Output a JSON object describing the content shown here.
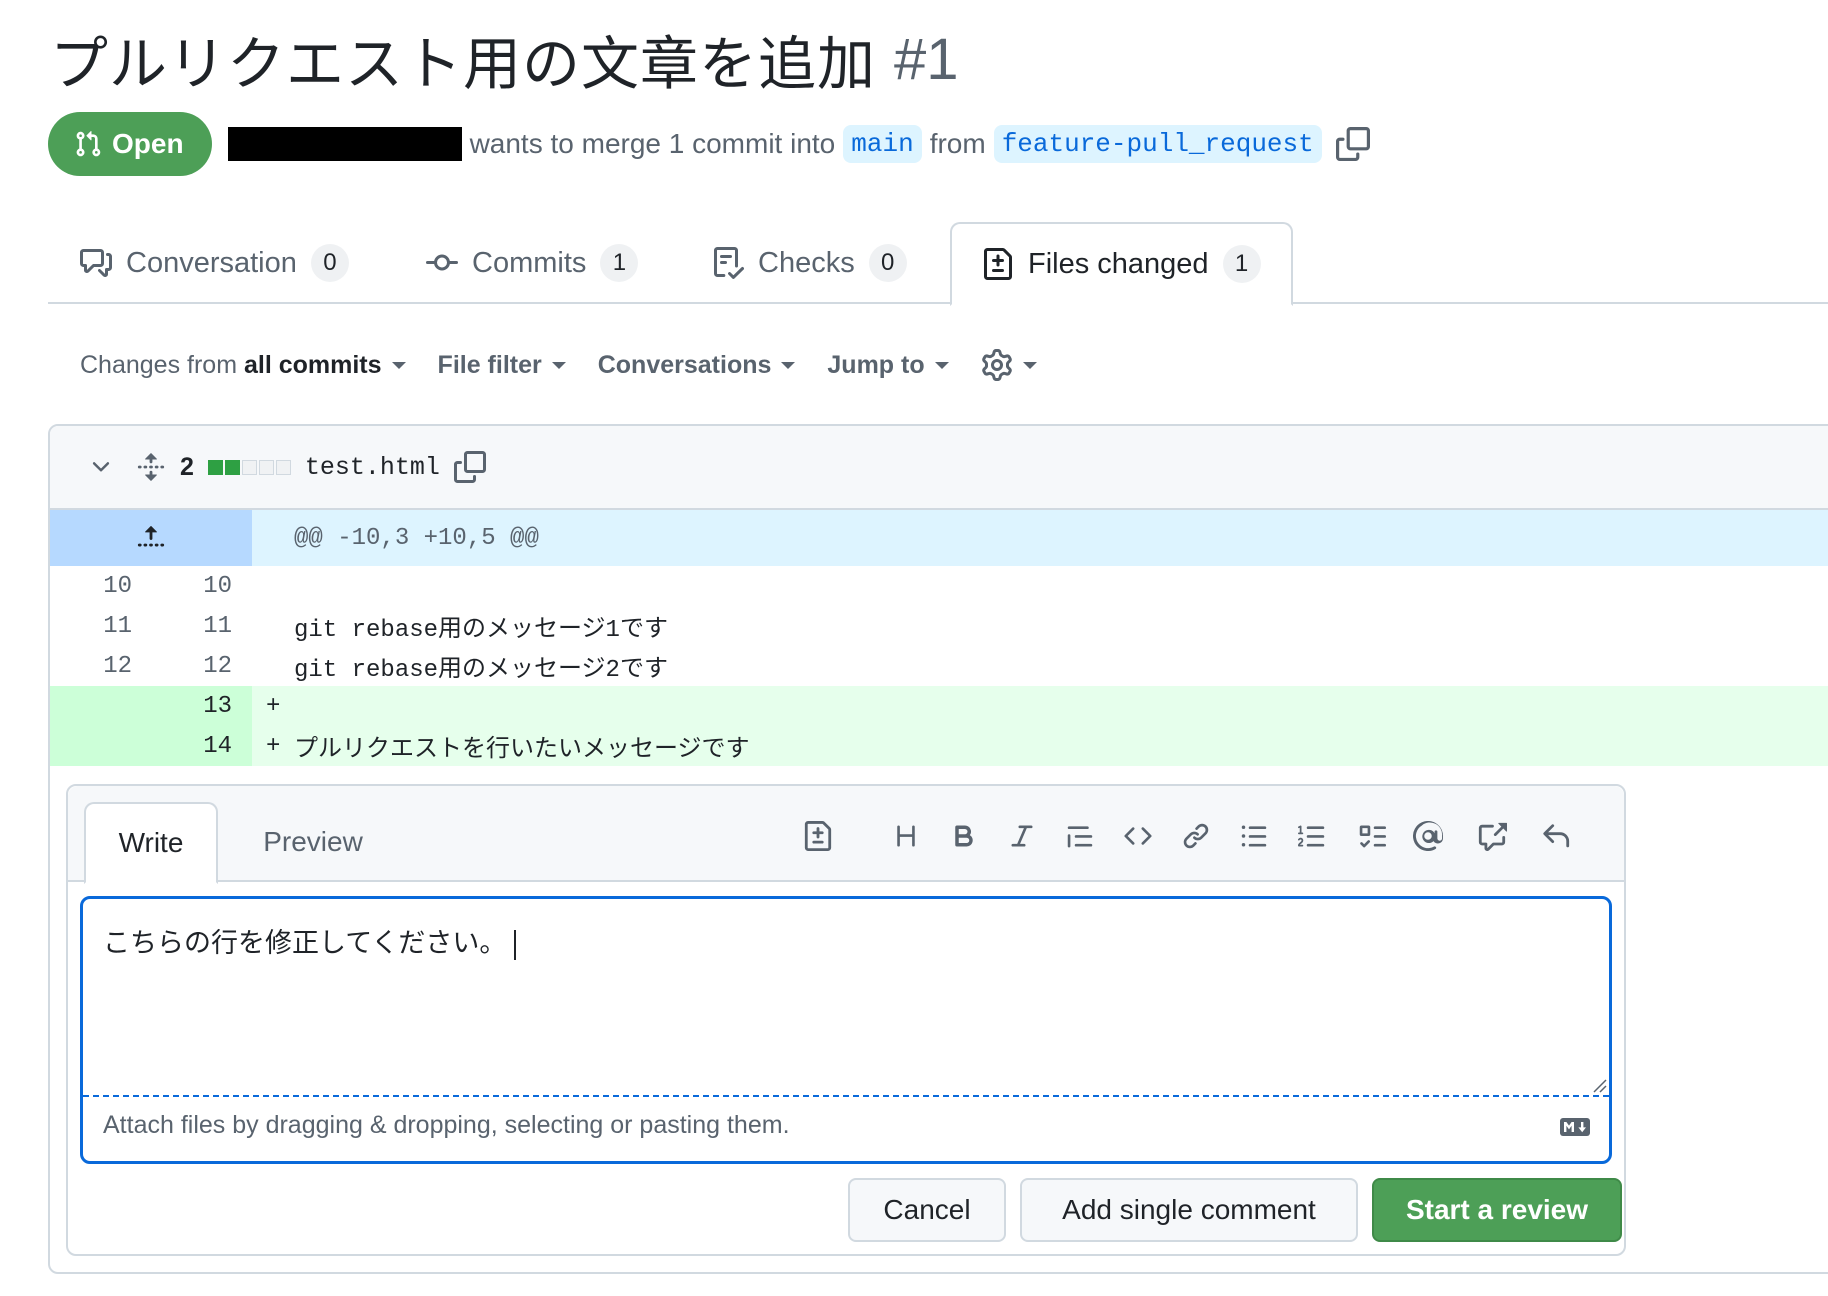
{
  "pr": {
    "title": "プルリクエスト用の文章を追加",
    "number": "#1",
    "state": "Open",
    "merge_text_1": "wants to merge 1 commit into",
    "base_branch": "main",
    "merge_text_2": "from",
    "head_branch": "feature-pull_request"
  },
  "tabs": [
    {
      "label": "Conversation",
      "count": "0",
      "icon": "comment-discussion-icon"
    },
    {
      "label": "Commits",
      "count": "1",
      "icon": "git-commit-icon"
    },
    {
      "label": "Checks",
      "count": "0",
      "icon": "checklist-icon"
    },
    {
      "label": "Files changed",
      "count": "1",
      "icon": "file-diff-icon",
      "selected": true
    }
  ],
  "toolbar": {
    "changes_prefix": "Changes from",
    "changes_value": "all commits",
    "file_filter": "File filter",
    "conversations": "Conversations",
    "jump_to": "Jump to"
  },
  "file": {
    "changes": "2",
    "diffstat": [
      "added",
      "added",
      "neutral",
      "neutral",
      "neutral"
    ],
    "name": "test.html",
    "hunk": "@@ -10,3 +10,5 @@",
    "lines": [
      {
        "old": "10",
        "new": "10",
        "type": "context",
        "sign": "",
        "text": ""
      },
      {
        "old": "11",
        "new": "11",
        "type": "context",
        "sign": "",
        "text": "git rebase用のメッセージ1です"
      },
      {
        "old": "12",
        "new": "12",
        "type": "context",
        "sign": "",
        "text": "git rebase用のメッセージ2です"
      },
      {
        "old": "",
        "new": "13",
        "type": "add",
        "sign": "+",
        "text": ""
      },
      {
        "old": "",
        "new": "14",
        "type": "add",
        "sign": "+",
        "text": "プルリクエストを行いたいメッセージです"
      }
    ]
  },
  "composer": {
    "write_tab": "Write",
    "preview_tab": "Preview",
    "text": "こちらの行を修正してください。",
    "attach_hint": "Attach files by dragging & dropping, selecting or pasting them.",
    "cancel": "Cancel",
    "add_single": "Add single comment",
    "start_review": "Start a review"
  },
  "colors": {
    "open_green": "#4d9f57",
    "link_blue": "#0969da",
    "addition_bg": "#e6ffec",
    "hunk_bg": "#ddf4ff"
  }
}
